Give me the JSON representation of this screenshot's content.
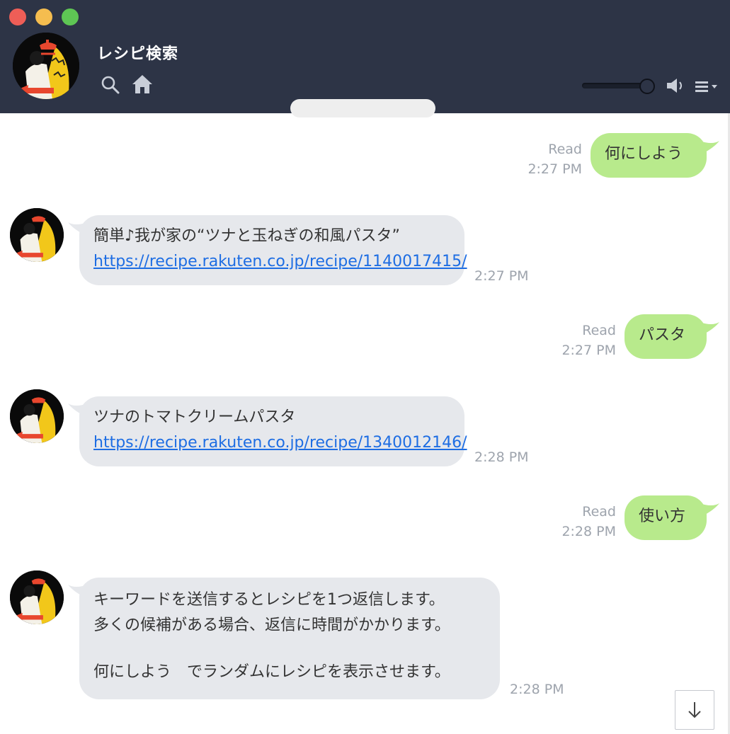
{
  "header": {
    "title": "レシピ検索",
    "icons": [
      "search-icon",
      "home-icon",
      "volume-icon",
      "menu-icon"
    ],
    "volume_level": 0.95,
    "background": "#2d3446"
  },
  "messages": [
    {
      "direction": "out",
      "text": "何にしよう",
      "status": "Read",
      "time": "2:27 PM"
    },
    {
      "direction": "in",
      "lines": [
        "簡単♪我が家の“ツナと玉ねぎの和風パスタ”"
      ],
      "link": "https://recipe.rakuten.co.jp/recipe/1140017415/",
      "time": "2:27 PM"
    },
    {
      "direction": "out",
      "text": "パスタ",
      "status": "Read",
      "time": "2:27 PM"
    },
    {
      "direction": "in",
      "lines": [
        "ツナのトマトクリームパスタ"
      ],
      "link": "https://recipe.rakuten.co.jp/recipe/1340012146/",
      "time": "2:28 PM"
    },
    {
      "direction": "out",
      "text": "使い方",
      "status": "Read",
      "time": "2:28 PM"
    },
    {
      "direction": "in",
      "lines": [
        "キーワードを送信するとレシピを1つ返信します。",
        "多くの候補がある場合、返信に時間がかかります。",
        "",
        "何にしよう　でランダムにレシピを表示させます。"
      ],
      "time": "2:28 PM"
    }
  ],
  "colors": {
    "outgoing_bubble": "#b8ea8c",
    "incoming_bubble": "#e6e8ec",
    "link": "#1d6de3",
    "meta_text": "#9ea4ad"
  },
  "scroll_button_icon": "arrow-down-icon"
}
